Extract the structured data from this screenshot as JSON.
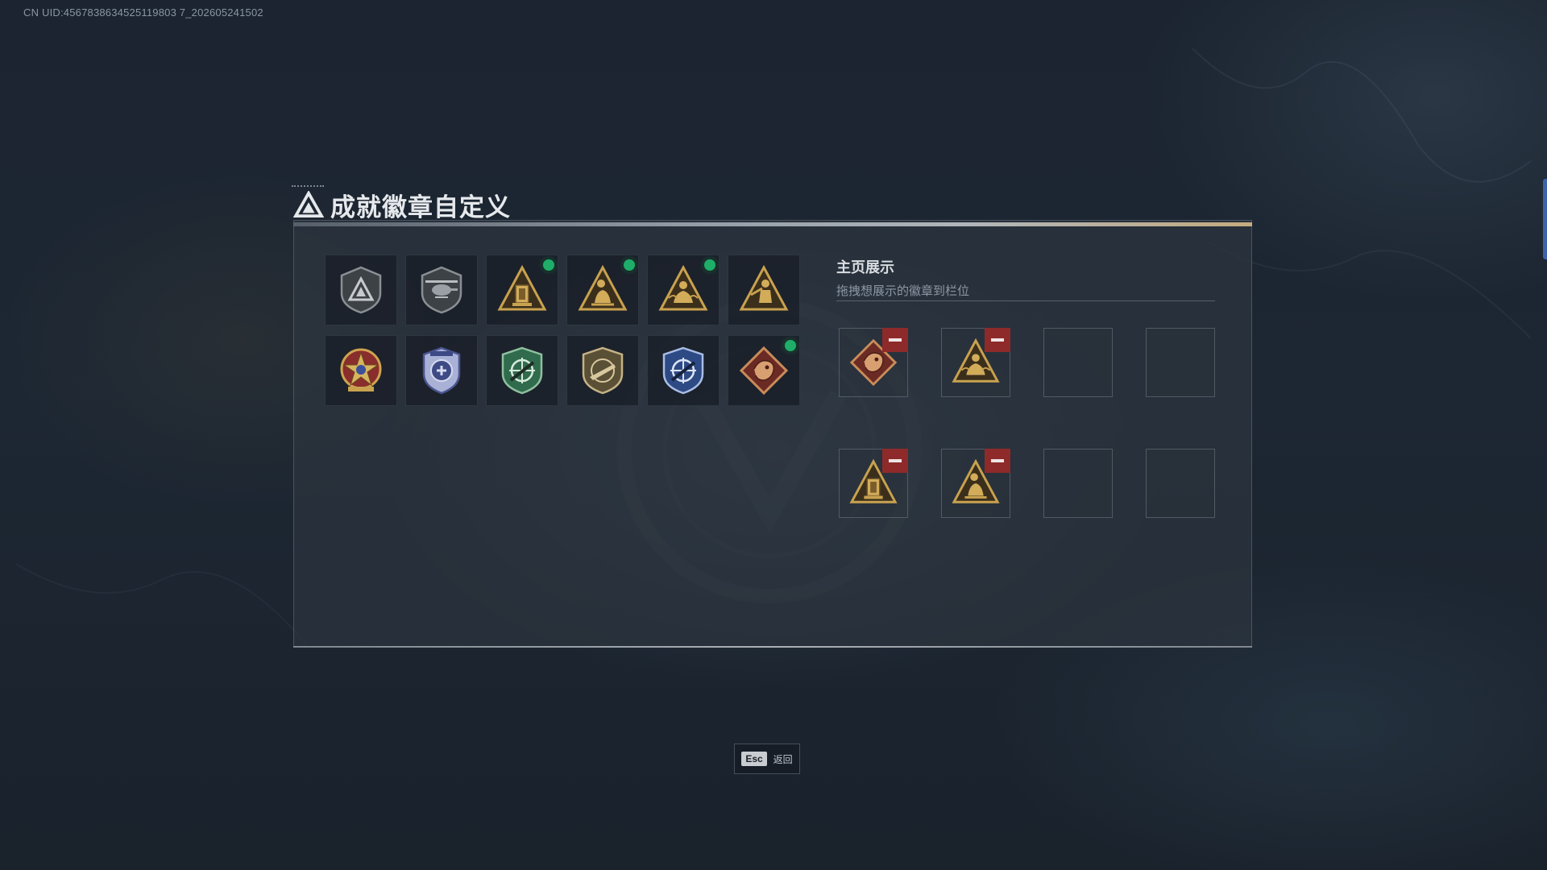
{
  "uid_text": "CN UID:4567838634525119803 7_202605241502",
  "title": "成就徽章自定义",
  "badges": [
    {
      "icon": "gray-shield-triangle-badge",
      "new": false
    },
    {
      "icon": "gray-helicopter-shield-badge",
      "new": false
    },
    {
      "icon": "gold-triangle-lantern-badge",
      "new": true
    },
    {
      "icon": "gold-triangle-crouching-figure-badge",
      "new": true
    },
    {
      "icon": "gold-triangle-kneeling-figure-badge",
      "new": true
    },
    {
      "icon": "gold-triangle-soldier-badge",
      "new": false
    },
    {
      "icon": "red-star-medal-badge",
      "new": false
    },
    {
      "icon": "blue-police-shield-badge",
      "new": false
    },
    {
      "icon": "green-crosshair-rifle-badge",
      "new": false
    },
    {
      "icon": "tan-rifle-shield-badge",
      "new": false
    },
    {
      "icon": "blue-crosshair-rifle-badge",
      "new": false
    },
    {
      "icon": "red-dragon-diamond-badge",
      "new": true
    }
  ],
  "display": {
    "title": "主页展示",
    "subtitle": "拖拽想展示的徽章到栏位",
    "slots": [
      {
        "icon": "red-dragon-diamond-badge",
        "filled": true
      },
      {
        "icon": "gold-triangle-kneeling-figure-badge",
        "filled": true
      },
      {
        "icon": "",
        "filled": false
      },
      {
        "icon": "",
        "filled": false
      },
      {
        "icon": "gold-triangle-lantern-badge",
        "filled": true
      },
      {
        "icon": "gold-triangle-crouching-figure-badge",
        "filled": true
      },
      {
        "icon": "",
        "filled": false
      },
      {
        "icon": "",
        "filled": false
      }
    ]
  },
  "esc": {
    "key": "Esc",
    "label": "返回"
  },
  "colors": {
    "new_dot": "#1fae6a",
    "remove": "#8e2a2a",
    "gold": "#c9a24f"
  }
}
